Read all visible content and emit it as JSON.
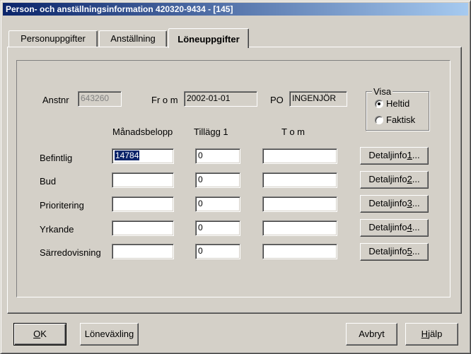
{
  "window": {
    "title": "Person- och anställningsinformation  420320-9434 - [145]"
  },
  "tabs": [
    {
      "label": "Personuppgifter",
      "active": false
    },
    {
      "label": "Anställning",
      "active": false
    },
    {
      "label": "Löneuppgifter",
      "active": true
    }
  ],
  "header": {
    "anstnr_label": "Anstnr",
    "anstnr_value": "643260",
    "from_label": "Fr o m",
    "from_value": "2002-01-01",
    "po_label": "PO",
    "po_value": "INGENJÖR"
  },
  "visa": {
    "legend": "Visa",
    "options": [
      {
        "label": "Heltid",
        "selected": true
      },
      {
        "label": "Faktisk",
        "selected": false
      }
    ]
  },
  "columns": {
    "manadsbelopp": "Månadsbelopp",
    "tillagg": "Tillägg 1",
    "tom": "T o m"
  },
  "rows": [
    {
      "label": "Befintlig",
      "manadsbelopp": "14784",
      "tillagg": "0",
      "tom": "",
      "button_prefix": "Detaljinfo",
      "button_key": "1",
      "button_suffix": "..."
    },
    {
      "label": "Bud",
      "manadsbelopp": "",
      "tillagg": "0",
      "tom": "",
      "button_prefix": "Detaljinfo",
      "button_key": "2",
      "button_suffix": "..."
    },
    {
      "label": "Prioritering",
      "manadsbelopp": "",
      "tillagg": "0",
      "tom": "",
      "button_prefix": "Detaljinfo",
      "button_key": "3",
      "button_suffix": "..."
    },
    {
      "label": "Yrkande",
      "manadsbelopp": "",
      "tillagg": "0",
      "tom": "",
      "button_prefix": "Detaljinfo",
      "button_key": "4",
      "button_suffix": "..."
    },
    {
      "label": "Särredovisning",
      "manadsbelopp": "",
      "tillagg": "0",
      "tom": "",
      "button_prefix": "Detaljinfo",
      "button_key": "5",
      "button_suffix": "..."
    }
  ],
  "footer": {
    "ok_key": "O",
    "ok_rest": "K",
    "lonevaxling": "Löneväxling",
    "avbryt": "Avbryt",
    "hjalp_key": "H",
    "hjalp_rest": "jälp"
  }
}
